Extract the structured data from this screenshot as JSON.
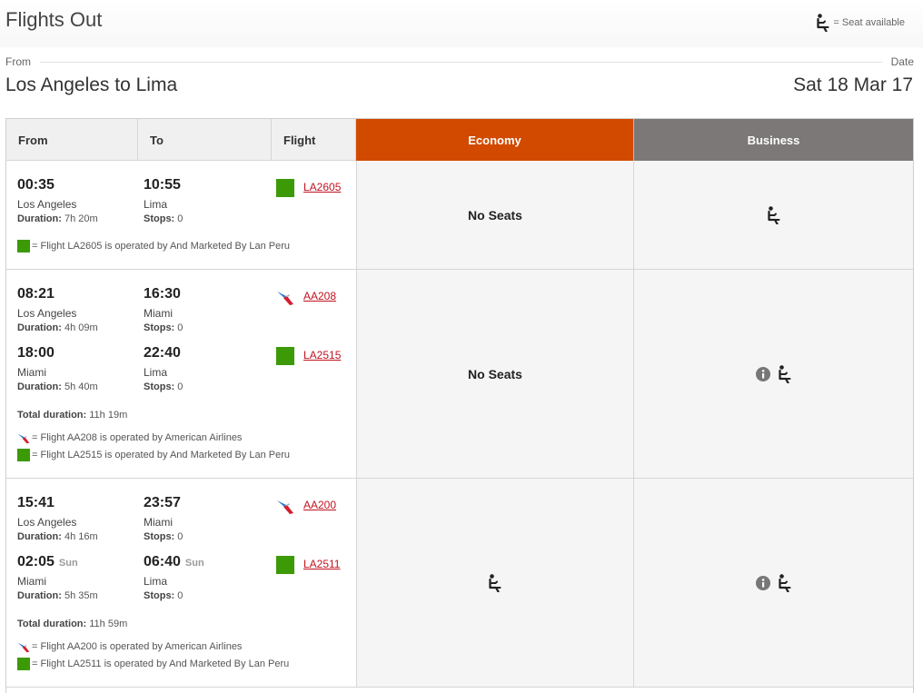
{
  "page": {
    "title": "Flights Out",
    "legend_label": "= Seat available",
    "from_label": "From",
    "date_label": "Date",
    "route": "Los Angeles to Lima",
    "date": "Sat 18 Mar 17"
  },
  "table": {
    "headers": {
      "from": "From",
      "to": "To",
      "flight": "Flight",
      "economy": "Economy",
      "business": "Business"
    }
  },
  "colors": {
    "economy": "#d24a00",
    "business": "#7d7878",
    "lan_peru": "#3c9a07",
    "link": "#c1121f"
  },
  "options": [
    {
      "segments": [
        {
          "dep_time": "00:35",
          "arr_time": "10:55",
          "dep_city": "Los Angeles",
          "arr_city": "Lima",
          "duration_label": "Duration:",
          "duration": "7h 20m",
          "stops_label": "Stops:",
          "stops": "0",
          "flight": "LA2605",
          "carrier_icon": "lan-peru-square-icon"
        }
      ],
      "operators": [
        {
          "text": "= Flight LA2605 is operated by And Marketed By Lan Peru",
          "icon": "lan-peru-square-icon"
        }
      ],
      "economy": "No Seats",
      "business": "seat-available"
    },
    {
      "segments": [
        {
          "dep_time": "08:21",
          "arr_time": "16:30",
          "dep_city": "Los Angeles",
          "arr_city": "Miami",
          "duration_label": "Duration:",
          "duration": "4h 09m",
          "stops_label": "Stops:",
          "stops": "0",
          "flight": "AA208",
          "carrier_icon": "american-airlines-icon"
        },
        {
          "dep_time": "18:00",
          "arr_time": "22:40",
          "dep_city": "Miami",
          "arr_city": "Lima",
          "duration_label": "Duration:",
          "duration": "5h 40m",
          "stops_label": "Stops:",
          "stops": "0",
          "flight": "LA2515",
          "carrier_icon": "lan-peru-square-icon"
        }
      ],
      "total_label": "Total duration:",
      "total": "11h 19m",
      "operators": [
        {
          "text": "= Flight AA208 is operated by American Airlines",
          "icon": "american-airlines-icon"
        },
        {
          "text": "= Flight LA2515 is operated by And Marketed By Lan Peru",
          "icon": "lan-peru-square-icon"
        }
      ],
      "economy": "No Seats",
      "business": "info + seat-available"
    },
    {
      "segments": [
        {
          "dep_time": "15:41",
          "arr_time": "23:57",
          "dep_city": "Los Angeles",
          "arr_city": "Miami",
          "duration_label": "Duration:",
          "duration": "4h 16m",
          "stops_label": "Stops:",
          "stops": "0",
          "flight": "AA200",
          "carrier_icon": "american-airlines-icon"
        },
        {
          "dep_time": "02:05",
          "dep_day": "Sun",
          "arr_time": "06:40",
          "arr_day": "Sun",
          "dep_city": "Miami",
          "arr_city": "Lima",
          "duration_label": "Duration:",
          "duration": "5h 35m",
          "stops_label": "Stops:",
          "stops": "0",
          "flight": "LA2511",
          "carrier_icon": "lan-peru-square-icon"
        }
      ],
      "total_label": "Total duration:",
      "total": "11h 59m",
      "operators": [
        {
          "text": "= Flight AA200 is operated by American Airlines",
          "icon": "american-airlines-icon"
        },
        {
          "text": "= Flight LA2511 is operated by And Marketed By Lan Peru",
          "icon": "lan-peru-square-icon"
        }
      ],
      "economy": "seat-available",
      "business": "info + seat-available"
    }
  ]
}
